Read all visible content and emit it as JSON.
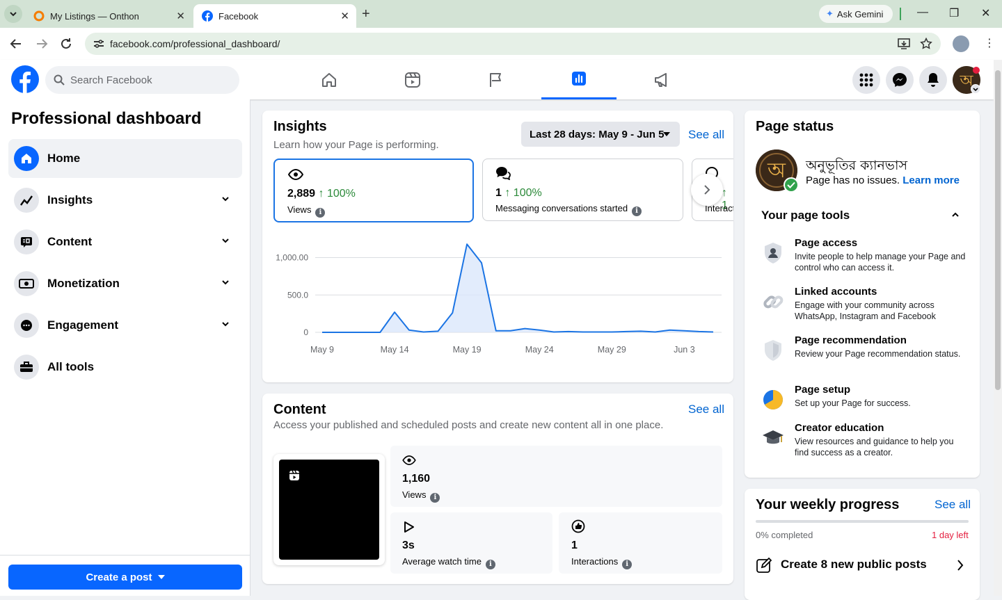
{
  "browser": {
    "tabs": [
      {
        "title": "My Listings — Onthon"
      },
      {
        "title": "Facebook"
      }
    ],
    "gemini_label": "Ask Gemini",
    "url": "facebook.com/professional_dashboard/"
  },
  "header": {
    "search_placeholder": "Search Facebook"
  },
  "sidebar": {
    "title": "Professional dashboard",
    "items": [
      {
        "label": "Home"
      },
      {
        "label": "Insights"
      },
      {
        "label": "Content"
      },
      {
        "label": "Monetization"
      },
      {
        "label": "Engagement"
      },
      {
        "label": "All tools"
      }
    ],
    "create_post": "Create a post"
  },
  "insights": {
    "title": "Insights",
    "subtitle": "Learn how your Page is performing.",
    "date_range": "Last 28 days: May 9 - Jun 5",
    "see_all": "See all",
    "metrics": [
      {
        "value": "2,889",
        "change": "↑ 100%",
        "label": "Views"
      },
      {
        "value": "1",
        "change": "↑ 100%",
        "label": "Messaging conversations started"
      },
      {
        "value": "",
        "change": "↑ 1",
        "label": "Interact"
      }
    ]
  },
  "chart_data": {
    "type": "area",
    "x": [
      "May 9",
      "May 10",
      "May 11",
      "May 12",
      "May 13",
      "May 14",
      "May 15",
      "May 16",
      "May 17",
      "May 18",
      "May 19",
      "May 20",
      "May 21",
      "May 22",
      "May 23",
      "May 24",
      "May 25",
      "May 26",
      "May 27",
      "May 28",
      "May 29",
      "May 30",
      "May 31",
      "Jun 1",
      "Jun 2",
      "Jun 3",
      "Jun 4",
      "Jun 5"
    ],
    "values": [
      0,
      0,
      0,
      0,
      0,
      270,
      30,
      5,
      15,
      260,
      1180,
      930,
      20,
      20,
      50,
      30,
      5,
      10,
      5,
      5,
      5,
      10,
      15,
      5,
      30,
      20,
      10,
      5
    ],
    "xticks": [
      "May 9",
      "May 14",
      "May 19",
      "May 24",
      "May 29",
      "Jun 3"
    ],
    "yticks": [
      "0",
      "500.0",
      "1,000.00"
    ],
    "ylim": [
      0,
      1200
    ],
    "grid": true,
    "color": "#1b74e4"
  },
  "content": {
    "title": "Content",
    "subtitle": "Access your published and scheduled posts and create new content all in one place.",
    "see_all": "See all",
    "views_value": "1,160",
    "views_label": "Views",
    "watch_value": "3s",
    "watch_label": "Average watch time",
    "inter_value": "1",
    "inter_label": "Interactions"
  },
  "page_status": {
    "title": "Page status",
    "page_name": "অনুভূতির ক্যানভাস",
    "status_text": "Page has no issues.",
    "learn_more": "Learn more",
    "tools_title": "Your page tools",
    "tools": [
      {
        "title": "Page access",
        "desc": "Invite people to help manage your Page and control who can access it."
      },
      {
        "title": "Linked accounts",
        "desc": "Engage with your community across WhatsApp, Instagram and Facebook"
      },
      {
        "title": "Page recommendation",
        "desc": "Review your Page recommendation status."
      },
      {
        "title": "Page setup",
        "desc": "Set up your Page for success."
      },
      {
        "title": "Creator education",
        "desc": "View resources and guidance to help you find success as a creator."
      }
    ]
  },
  "weekly": {
    "title": "Your weekly progress",
    "see_all": "See all",
    "completed": "0% completed",
    "time_left": "1 day left",
    "progress": 0,
    "task": "Create 8 new public posts"
  },
  "colors": {
    "brand": "#0866ff",
    "link": "#0064d1",
    "positive": "#2c8a3a",
    "alert": "#e41e3f"
  }
}
